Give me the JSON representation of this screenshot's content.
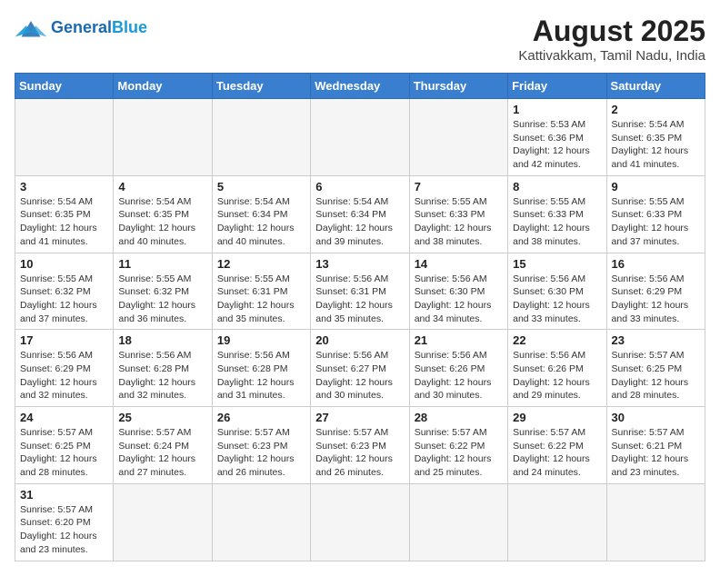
{
  "header": {
    "logo_text_normal": "General",
    "logo_text_accent": "Blue",
    "title": "August 2025",
    "subtitle": "Kattivakkam, Tamil Nadu, India"
  },
  "days_of_week": [
    "Sunday",
    "Monday",
    "Tuesday",
    "Wednesday",
    "Thursday",
    "Friday",
    "Saturday"
  ],
  "weeks": [
    [
      {
        "day": null,
        "info": null
      },
      {
        "day": null,
        "info": null
      },
      {
        "day": null,
        "info": null
      },
      {
        "day": null,
        "info": null
      },
      {
        "day": null,
        "info": null
      },
      {
        "day": "1",
        "info": "Sunrise: 5:53 AM\nSunset: 6:36 PM\nDaylight: 12 hours and 42 minutes."
      },
      {
        "day": "2",
        "info": "Sunrise: 5:54 AM\nSunset: 6:35 PM\nDaylight: 12 hours and 41 minutes."
      }
    ],
    [
      {
        "day": "3",
        "info": "Sunrise: 5:54 AM\nSunset: 6:35 PM\nDaylight: 12 hours and 41 minutes."
      },
      {
        "day": "4",
        "info": "Sunrise: 5:54 AM\nSunset: 6:35 PM\nDaylight: 12 hours and 40 minutes."
      },
      {
        "day": "5",
        "info": "Sunrise: 5:54 AM\nSunset: 6:34 PM\nDaylight: 12 hours and 40 minutes."
      },
      {
        "day": "6",
        "info": "Sunrise: 5:54 AM\nSunset: 6:34 PM\nDaylight: 12 hours and 39 minutes."
      },
      {
        "day": "7",
        "info": "Sunrise: 5:55 AM\nSunset: 6:33 PM\nDaylight: 12 hours and 38 minutes."
      },
      {
        "day": "8",
        "info": "Sunrise: 5:55 AM\nSunset: 6:33 PM\nDaylight: 12 hours and 38 minutes."
      },
      {
        "day": "9",
        "info": "Sunrise: 5:55 AM\nSunset: 6:33 PM\nDaylight: 12 hours and 37 minutes."
      }
    ],
    [
      {
        "day": "10",
        "info": "Sunrise: 5:55 AM\nSunset: 6:32 PM\nDaylight: 12 hours and 37 minutes."
      },
      {
        "day": "11",
        "info": "Sunrise: 5:55 AM\nSunset: 6:32 PM\nDaylight: 12 hours and 36 minutes."
      },
      {
        "day": "12",
        "info": "Sunrise: 5:55 AM\nSunset: 6:31 PM\nDaylight: 12 hours and 35 minutes."
      },
      {
        "day": "13",
        "info": "Sunrise: 5:56 AM\nSunset: 6:31 PM\nDaylight: 12 hours and 35 minutes."
      },
      {
        "day": "14",
        "info": "Sunrise: 5:56 AM\nSunset: 6:30 PM\nDaylight: 12 hours and 34 minutes."
      },
      {
        "day": "15",
        "info": "Sunrise: 5:56 AM\nSunset: 6:30 PM\nDaylight: 12 hours and 33 minutes."
      },
      {
        "day": "16",
        "info": "Sunrise: 5:56 AM\nSunset: 6:29 PM\nDaylight: 12 hours and 33 minutes."
      }
    ],
    [
      {
        "day": "17",
        "info": "Sunrise: 5:56 AM\nSunset: 6:29 PM\nDaylight: 12 hours and 32 minutes."
      },
      {
        "day": "18",
        "info": "Sunrise: 5:56 AM\nSunset: 6:28 PM\nDaylight: 12 hours and 32 minutes."
      },
      {
        "day": "19",
        "info": "Sunrise: 5:56 AM\nSunset: 6:28 PM\nDaylight: 12 hours and 31 minutes."
      },
      {
        "day": "20",
        "info": "Sunrise: 5:56 AM\nSunset: 6:27 PM\nDaylight: 12 hours and 30 minutes."
      },
      {
        "day": "21",
        "info": "Sunrise: 5:56 AM\nSunset: 6:26 PM\nDaylight: 12 hours and 30 minutes."
      },
      {
        "day": "22",
        "info": "Sunrise: 5:56 AM\nSunset: 6:26 PM\nDaylight: 12 hours and 29 minutes."
      },
      {
        "day": "23",
        "info": "Sunrise: 5:57 AM\nSunset: 6:25 PM\nDaylight: 12 hours and 28 minutes."
      }
    ],
    [
      {
        "day": "24",
        "info": "Sunrise: 5:57 AM\nSunset: 6:25 PM\nDaylight: 12 hours and 28 minutes."
      },
      {
        "day": "25",
        "info": "Sunrise: 5:57 AM\nSunset: 6:24 PM\nDaylight: 12 hours and 27 minutes."
      },
      {
        "day": "26",
        "info": "Sunrise: 5:57 AM\nSunset: 6:23 PM\nDaylight: 12 hours and 26 minutes."
      },
      {
        "day": "27",
        "info": "Sunrise: 5:57 AM\nSunset: 6:23 PM\nDaylight: 12 hours and 26 minutes."
      },
      {
        "day": "28",
        "info": "Sunrise: 5:57 AM\nSunset: 6:22 PM\nDaylight: 12 hours and 25 minutes."
      },
      {
        "day": "29",
        "info": "Sunrise: 5:57 AM\nSunset: 6:22 PM\nDaylight: 12 hours and 24 minutes."
      },
      {
        "day": "30",
        "info": "Sunrise: 5:57 AM\nSunset: 6:21 PM\nDaylight: 12 hours and 23 minutes."
      }
    ],
    [
      {
        "day": "31",
        "info": "Sunrise: 5:57 AM\nSunset: 6:20 PM\nDaylight: 12 hours and 23 minutes."
      },
      {
        "day": null,
        "info": null
      },
      {
        "day": null,
        "info": null
      },
      {
        "day": null,
        "info": null
      },
      {
        "day": null,
        "info": null
      },
      {
        "day": null,
        "info": null
      },
      {
        "day": null,
        "info": null
      }
    ]
  ]
}
